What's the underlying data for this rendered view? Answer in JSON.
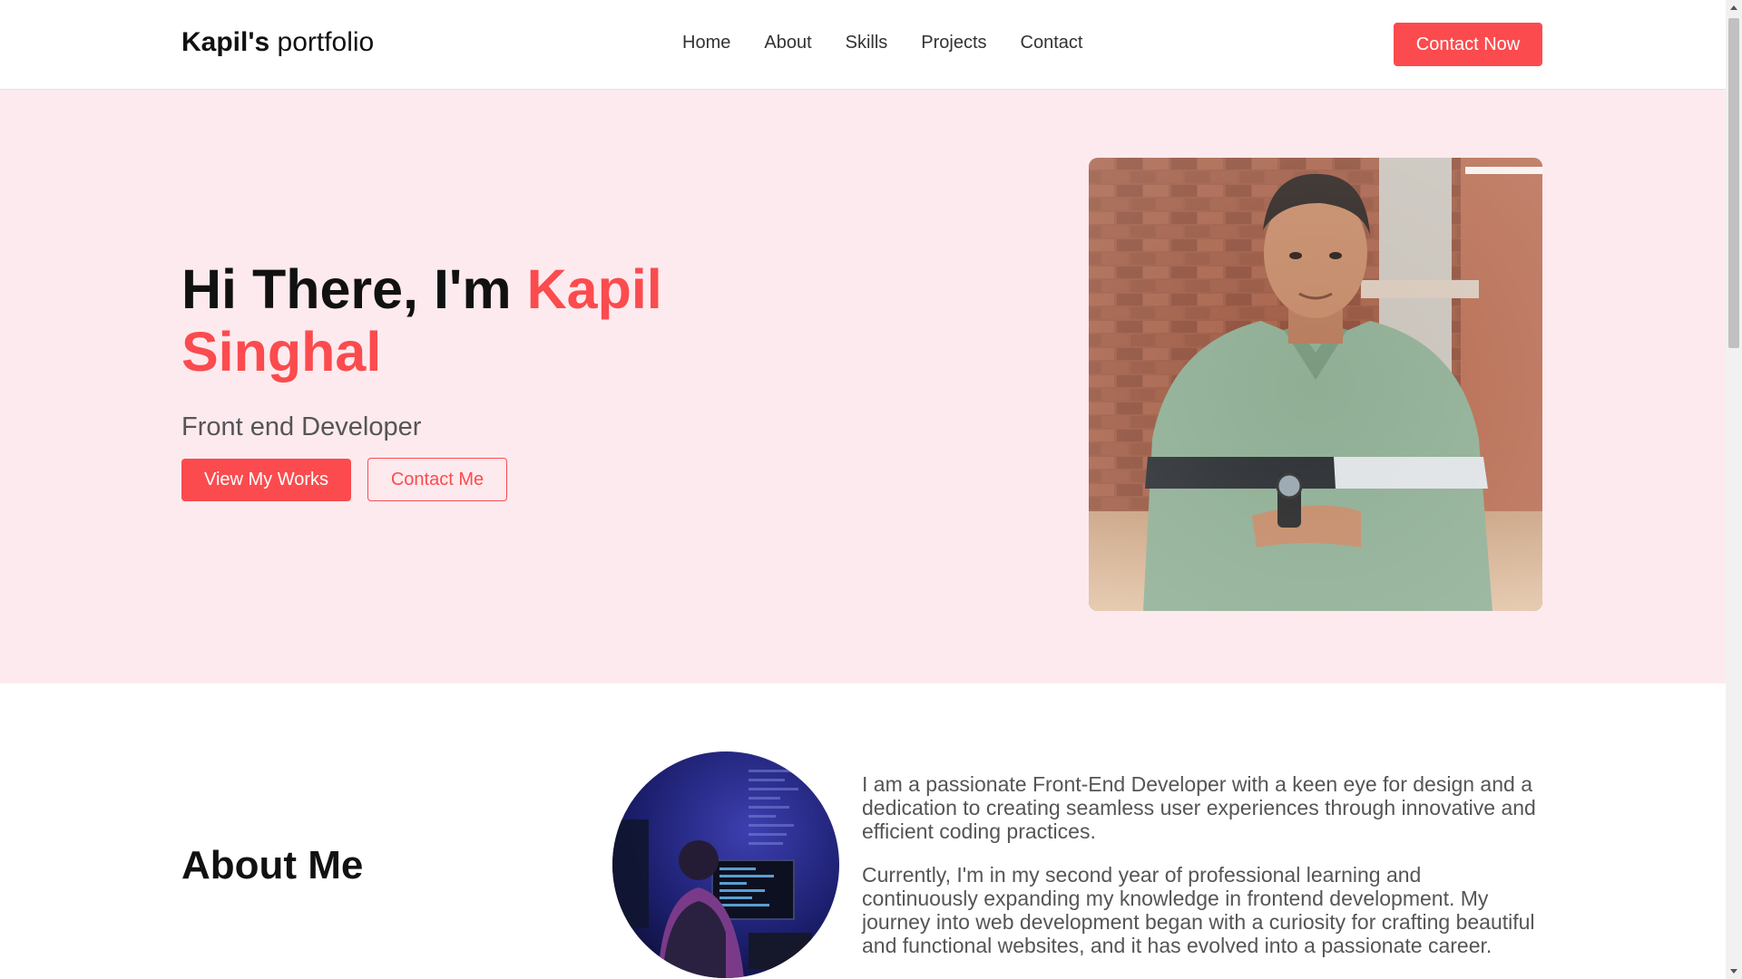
{
  "header": {
    "logo_bold": "Kapil's",
    "logo_rest": " portfolio",
    "nav": [
      "Home",
      "About",
      "Skills",
      "Projects",
      "Contact"
    ],
    "cta": "Contact Now"
  },
  "hero": {
    "greeting": "Hi There, I'm ",
    "name": "Kapil Singhal",
    "subtitle": "Front end Developer",
    "primary_button": "View My Works",
    "secondary_button": "Contact Me"
  },
  "about": {
    "title": "About Me",
    "paragraphs": [
      "I am a passionate Front-End Developer with a keen eye for design and a dedication to creating seamless user experiences through innovative and efficient coding practices.",
      "Currently, I'm in my second year of professional learning and continuously expanding my knowledge in frontend development. My journey into web development began with a curiosity for crafting beautiful and functional websites, and it has evolved into a passionate career."
    ]
  },
  "colors": {
    "accent": "#fb4b4e",
    "hero_bg": "#fdeaee"
  }
}
